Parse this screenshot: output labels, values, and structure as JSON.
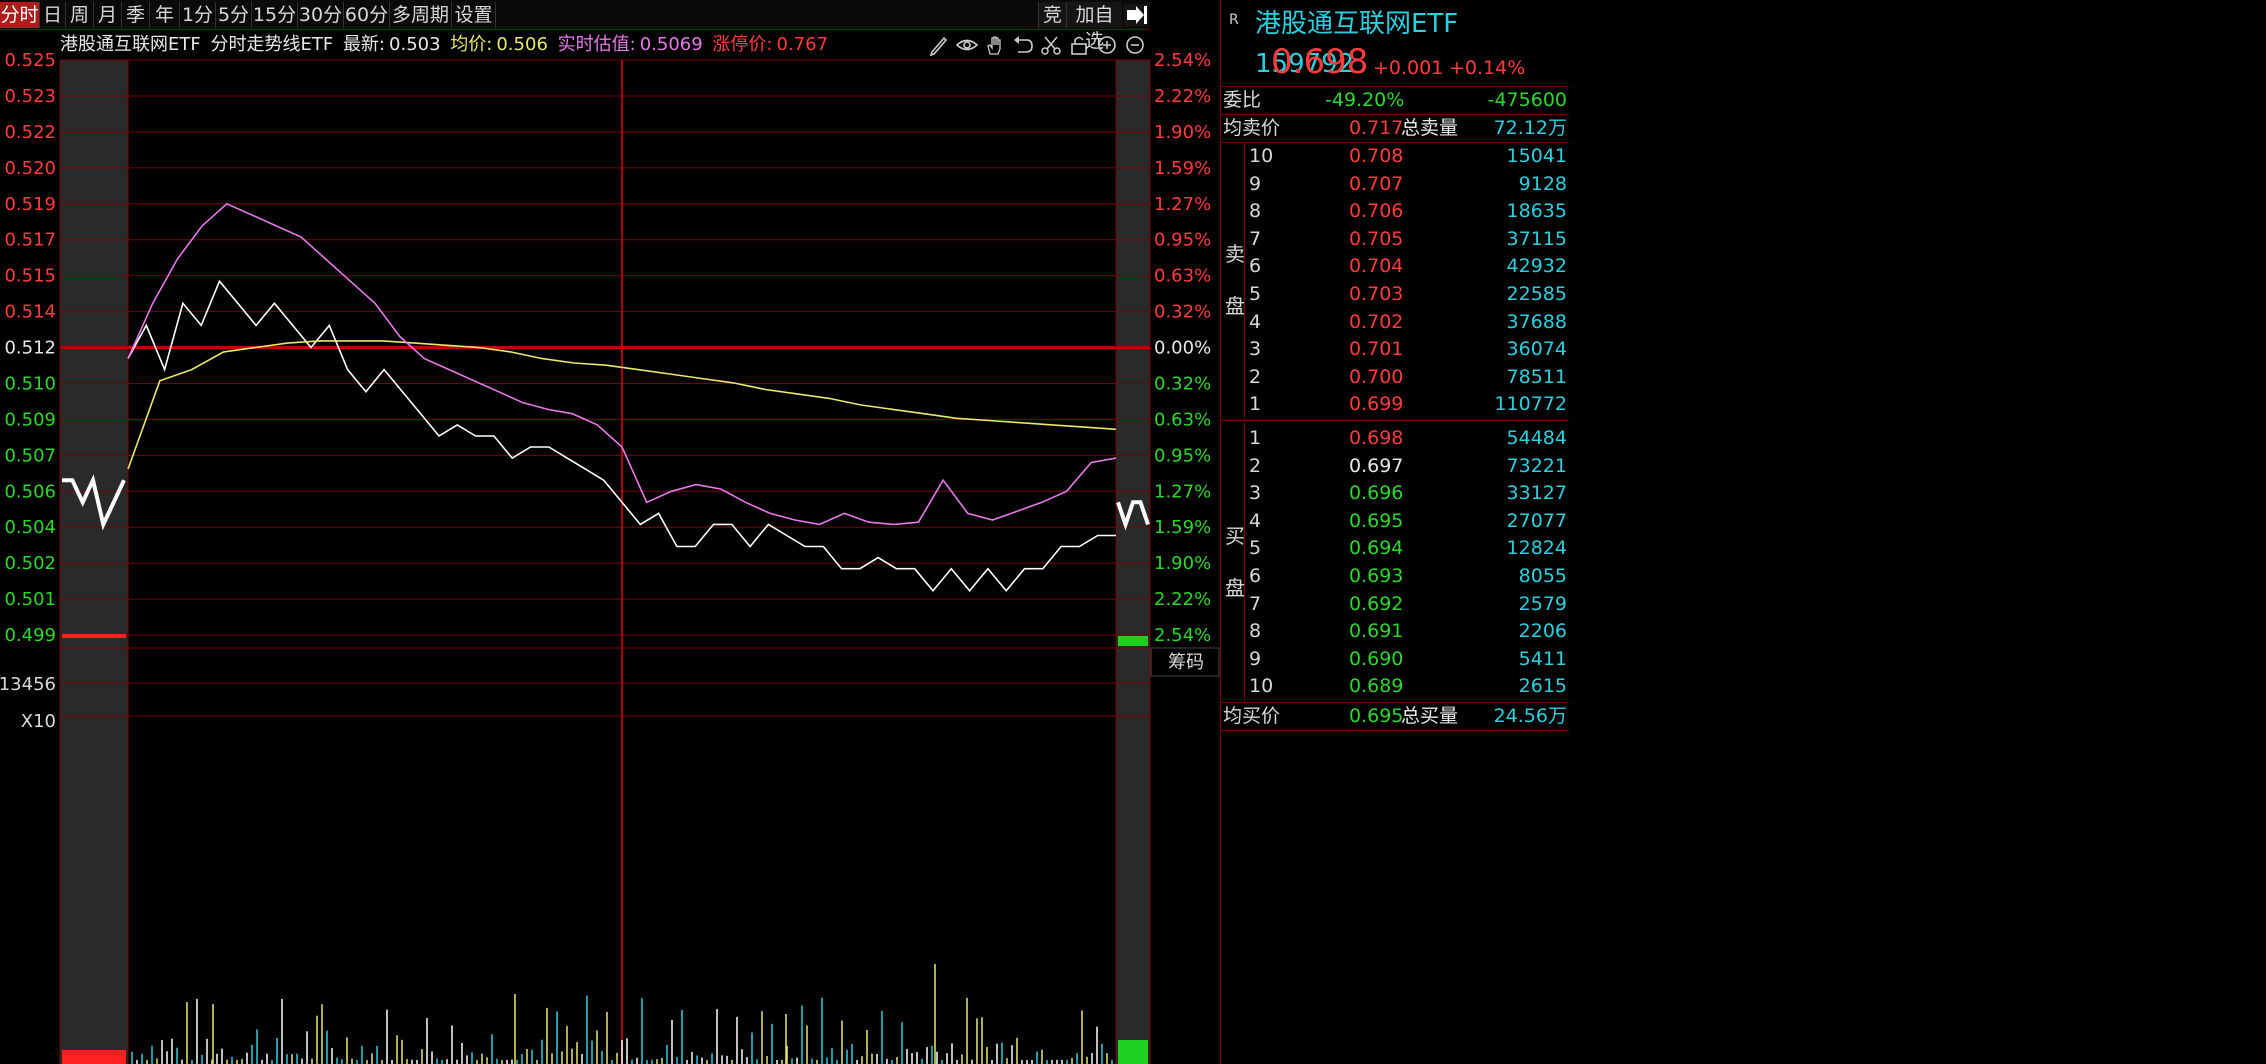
{
  "toolbar": {
    "tabs": [
      "分时",
      "日",
      "周",
      "月",
      "季",
      "年",
      "1分",
      "5分",
      "15分",
      "30分",
      "60分",
      "多周期",
      "设置"
    ],
    "auction_label": "竞",
    "watchlist_label": "加自选"
  },
  "header": {
    "name": "港股通互联网ETF",
    "chart_name": "分时走势线ETF",
    "latest_label": "最新:",
    "latest": "0.503",
    "avg_label": "均价:",
    "avg": "0.506",
    "iopv_label": "实时估值:",
    "iopv": "0.5069",
    "limit_label": "涨停价:",
    "limit": "0.767"
  },
  "colors": {
    "up": "#ff3b3b",
    "down": "#2bd82b",
    "price_line": "#ffffff",
    "avg_line": "#e8e86a",
    "iopv_line": "#e878e8",
    "grid": "#7a0000",
    "vol_cyan": "#2ad0e0",
    "vol_white": "#ffffff",
    "vol_yellow": "#e8e86a"
  },
  "chip_label": "筹码",
  "volume_axis": {
    "label": "13456",
    "multiplier": "X10"
  },
  "chart_data": {
    "type": "line",
    "y_left_ticks": [
      "0.525",
      "0.523",
      "0.522",
      "0.520",
      "0.519",
      "0.517",
      "0.515",
      "0.514",
      "0.512",
      "0.510",
      "0.509",
      "0.507",
      "0.506",
      "0.504",
      "0.502",
      "0.501",
      "0.499"
    ],
    "y_right_ticks": [
      "2.54%",
      "2.22%",
      "1.90%",
      "1.59%",
      "1.27%",
      "0.95%",
      "0.63%",
      "0.32%",
      "0.00%",
      "0.32%",
      "0.63%",
      "0.95%",
      "1.27%",
      "1.59%",
      "1.90%",
      "2.22%",
      "2.54%"
    ],
    "ylim": [
      0.499,
      0.525
    ],
    "prev_close": 0.512,
    "series": [
      {
        "values": [
          0.5115,
          0.513,
          0.511,
          0.514,
          0.513,
          0.515,
          0.514,
          0.513,
          0.514,
          0.513,
          0.512,
          0.513,
          0.511,
          0.51,
          0.511,
          0.51,
          0.509,
          0.508,
          0.5085,
          0.508,
          0.508,
          0.507,
          0.5075,
          0.5075,
          0.507,
          0.5065,
          0.506,
          0.505,
          0.504,
          0.5045,
          0.503,
          0.503,
          0.504,
          0.504,
          0.503,
          0.504,
          0.5035,
          0.503,
          0.503,
          0.502,
          0.502,
          0.5025,
          0.502,
          0.502,
          0.501,
          0.502,
          0.501,
          0.502,
          0.501,
          0.502,
          0.502,
          0.503,
          0.503,
          0.5035,
          0.5035
        ]
      },
      {
        "values": [
          0.5065,
          0.5105,
          0.511,
          0.5118,
          0.512,
          0.5122,
          0.5123,
          0.5123,
          0.5123,
          0.5122,
          0.5121,
          0.512,
          0.5118,
          0.5115,
          0.5113,
          0.5112,
          0.511,
          0.5108,
          0.5106,
          0.5104,
          0.5101,
          0.5099,
          0.5097,
          0.5094,
          0.5092,
          0.509,
          0.5088,
          0.5087,
          0.5086,
          0.5085,
          0.5084,
          0.5083
        ]
      },
      {
        "values": [
          0.5115,
          0.514,
          0.516,
          0.5175,
          0.5185,
          0.518,
          0.5175,
          0.517,
          0.516,
          0.515,
          0.514,
          0.5125,
          0.5115,
          0.511,
          0.5105,
          0.51,
          0.5095,
          0.5092,
          0.509,
          0.5085,
          0.5075,
          0.505,
          0.5055,
          0.5058,
          0.5056,
          0.505,
          0.5045,
          0.5042,
          0.504,
          0.5045,
          0.5041,
          0.504,
          0.5041,
          0.506,
          0.5045,
          0.5042,
          0.5046,
          0.505,
          0.5055,
          0.5068,
          0.507
        ]
      }
    ]
  },
  "quote": {
    "title": "港股通互联网ETF 159792",
    "price": "0.698",
    "change": "+0.001",
    "change_pct": "+0.14%",
    "ratio_label": "委比",
    "ratio": "-49.20%",
    "ratio_diff": "-475600",
    "avg_sell_label": "均卖价",
    "avg_sell": "0.717",
    "total_sell_label": "总卖量",
    "total_sell": "72.12万",
    "sell_side": [
      "卖",
      "盘"
    ],
    "buy_side": [
      "买",
      "盘"
    ],
    "asks": [
      {
        "level": "10",
        "price": "0.708",
        "vol": "15041"
      },
      {
        "level": "9",
        "price": "0.707",
        "vol": "9128"
      },
      {
        "level": "8",
        "price": "0.706",
        "vol": "18635"
      },
      {
        "level": "7",
        "price": "0.705",
        "vol": "37115"
      },
      {
        "level": "6",
        "price": "0.704",
        "vol": "42932"
      },
      {
        "level": "5",
        "price": "0.703",
        "vol": "22585"
      },
      {
        "level": "4",
        "price": "0.702",
        "vol": "37688"
      },
      {
        "level": "3",
        "price": "0.701",
        "vol": "36074"
      },
      {
        "level": "2",
        "price": "0.700",
        "vol": "78511"
      },
      {
        "level": "1",
        "price": "0.699",
        "vol": "110772"
      }
    ],
    "bids": [
      {
        "level": "1",
        "price": "0.698",
        "vol": "54484"
      },
      {
        "level": "2",
        "price": "0.697",
        "vol": "73221"
      },
      {
        "level": "3",
        "price": "0.696",
        "vol": "33127"
      },
      {
        "level": "4",
        "price": "0.695",
        "vol": "27077"
      },
      {
        "level": "5",
        "price": "0.694",
        "vol": "12824"
      },
      {
        "level": "6",
        "price": "0.693",
        "vol": "8055"
      },
      {
        "level": "7",
        "price": "0.692",
        "vol": "2579"
      },
      {
        "level": "8",
        "price": "0.691",
        "vol": "2206"
      },
      {
        "level": "9",
        "price": "0.690",
        "vol": "5411"
      },
      {
        "level": "10",
        "price": "0.689",
        "vol": "2615"
      }
    ],
    "avg_buy_label": "均买价",
    "avg_buy": "0.695",
    "total_buy_label": "总买量",
    "total_buy": "24.56万"
  }
}
